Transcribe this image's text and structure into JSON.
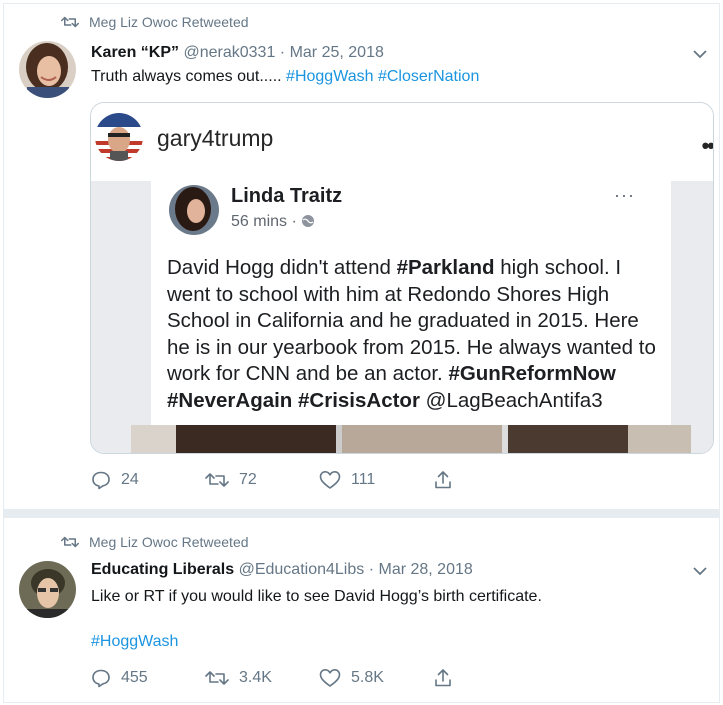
{
  "tweets": [
    {
      "retweeted_by": "Meg Liz Owoc Retweeted",
      "name": "Karen “KP”",
      "handle": "@nerak0331",
      "sep": "·",
      "date": "Mar 25, 2018",
      "text": "Truth always comes out.....",
      "hashtags": [
        "#HoggWash",
        "#CloserNation"
      ],
      "embed": {
        "username": "gary4trump",
        "more": "••",
        "fb_post": {
          "name": "Linda Traitz",
          "time": "56 mins ·",
          "more": "···",
          "text_segments": [
            {
              "t": "David Hogg didn't attend ",
              "b": false
            },
            {
              "t": "#Parkland",
              "b": true
            },
            {
              "t": " high school. I went to school with him at Redondo Shores High School in California and he graduated in 2015. Here he is in our yearbook from 2015. He always wanted to work for CNN and be an actor. ",
              "b": false
            },
            {
              "t": "#GunReformNow #NeverAgain #CrisisActor",
              "b": true
            },
            {
              "t": " @LagBeachAntifa3",
              "b": false
            }
          ]
        }
      },
      "actions": {
        "replies": "24",
        "retweets": "72",
        "likes": "111"
      }
    },
    {
      "retweeted_by": "Meg Liz Owoc Retweeted",
      "name": "Educating Liberals",
      "handle": "@Education4Libs",
      "sep": "·",
      "date": "Mar 28, 2018",
      "text": "Like or RT if you would like to see David Hogg’s birth certificate.",
      "hashtags": [
        "#HoggWash"
      ],
      "actions": {
        "replies": "455",
        "retweets": "3.4K",
        "likes": "5.8K"
      }
    }
  ],
  "icons": {
    "retweet": "retweet-icon",
    "reply": "reply-icon",
    "like": "heart-icon",
    "share": "share-icon",
    "menu": "chevron-down-icon",
    "globe": "globe-icon"
  },
  "colors": {
    "link": "#1b95e0",
    "muted": "#657786",
    "border": "#e6ecf0"
  }
}
